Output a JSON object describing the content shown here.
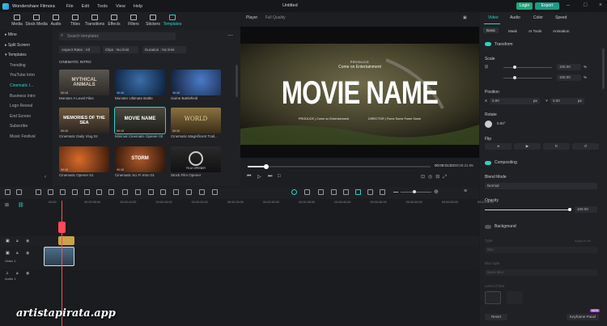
{
  "app": {
    "title": "Wondershare Filmora",
    "menu": [
      "File",
      "Edit",
      "Tools",
      "View",
      "Help"
    ],
    "project": "Untitled",
    "login": "Login",
    "export": "Export"
  },
  "toolbar": [
    {
      "label": "Media",
      "icon": "media-icon"
    },
    {
      "label": "Stock Media",
      "icon": "stock-media-icon"
    },
    {
      "label": "Audio",
      "icon": "audio-icon"
    },
    {
      "label": "Titles",
      "icon": "titles-icon"
    },
    {
      "label": "Transitions",
      "icon": "transitions-icon"
    },
    {
      "label": "Effects",
      "icon": "effects-icon"
    },
    {
      "label": "Filters",
      "icon": "filters-icon"
    },
    {
      "label": "Stickers",
      "icon": "stickers-icon"
    },
    {
      "label": "Templates",
      "icon": "templates-icon"
    }
  ],
  "sidebar": {
    "items": [
      "Mine",
      "Split Screen",
      "Templates",
      "Trending",
      "YouTube Intro",
      "Cinematic I...",
      "Business Intro",
      "Logo Reveal",
      "End Screen",
      "Subscribe",
      "Music Festival"
    ]
  },
  "library": {
    "search_placeholder": "Search templates",
    "filters": [
      "Aspect Ratio : All",
      "Clips : No limit",
      "Duration : No limit"
    ],
    "category": "CINEMATIC INTRO",
    "cards": [
      {
        "name": "Monster A Level Files",
        "dur": "00:15",
        "thumb_text": "MYTHICAL ANIMALS"
      },
      {
        "name": "Monster Ultimate Battle",
        "dur": "00:10",
        "thumb_text": ""
      },
      {
        "name": "Game Battlefield",
        "dur": "00:10",
        "thumb_text": ""
      },
      {
        "name": "Cinematic Daily Vlog 02",
        "dur": "00:10",
        "thumb_text": "MEMORIES OF THE SEA"
      },
      {
        "name": "Minimal Cinematic Opener 02",
        "dur": "00:10",
        "thumb_text": "MOVIE NAME"
      },
      {
        "name": "Cinematic Magnificent Trail...",
        "dur": "00:10",
        "thumb_text": "WORLD"
      },
      {
        "name": "Cinematic Opener 01",
        "dur": "00:10",
        "thumb_text": ""
      },
      {
        "name": "Cinematic Sci Fi Intro 01",
        "dur": "00:10",
        "thumb_text": "STORM"
      },
      {
        "name": "Stock Film Opener",
        "dur": "00:10",
        "thumb_text": "FILM OPENER"
      }
    ]
  },
  "player": {
    "tab": "Player",
    "quality": "Full Quality",
    "small_top": "PRODUCE",
    "small_sub": "Come on Entertainment",
    "big_title": "MOVIE NAME",
    "credit_left": "PRODUCE | Come on Entertainment",
    "credit_right": "DIRECTOR | Fome Some Fome Some",
    "time_current": "00:00:01:23",
    "time_total": "00:00:21:06",
    "progress": 0.1
  },
  "inspector": {
    "tabs": [
      "Video",
      "Audio",
      "Color",
      "Speed"
    ],
    "subtabs": [
      "Basic",
      "Mask",
      "AI Tools",
      "Animation"
    ],
    "transform": "Transform",
    "scale_label": "Scale",
    "scale_x": "100.00",
    "scale_y": "100.00",
    "unit_pct": "%",
    "position_label": "Position",
    "pos_x": "0.00",
    "pos_y": "0.00",
    "unit_px": "px",
    "rotate_label": "Rotate",
    "rotate_value": "0.00°",
    "flip_label": "Flip",
    "compositing": "Compositing",
    "blend_label": "Blend Mode",
    "blend_value": "Normal",
    "opacity_label": "Opacity",
    "opacity_value": "100.00",
    "background": "Background",
    "type_label": "Type",
    "apply_all": "Apply to All",
    "type_value": "Blur",
    "blur_style_label": "Blur style",
    "blur_style_value": "Basic Blur",
    "level_label": "Level of blur",
    "reset": "Reset",
    "keyframe": "Keyframe Panel",
    "new_badge": "NEW"
  },
  "timeline": {
    "ruler": [
      "00:00",
      "00:00:05:00",
      "00:00:10:00",
      "00:00:15:00",
      "00:00:20:00",
      "00:00:25:00",
      "00:00:30:00",
      "00:00:35:00",
      "00:00:40:00",
      "00:00:45:00",
      "00:00:50:00",
      "00:00:55:00",
      "00:01:00:00"
    ],
    "video_track": "Video 1",
    "audio_track": "Audio 1"
  },
  "watermark": "artistapirata.app",
  "colors": {
    "accent": "#31d0c3",
    "playhead": "#ff4a5a",
    "export": "#1a9b86"
  }
}
